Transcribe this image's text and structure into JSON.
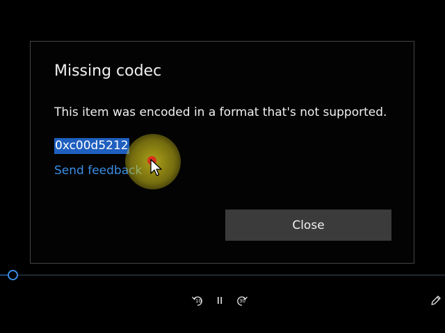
{
  "dialog": {
    "title": "Missing codec",
    "message": "This item was encoded in a format that's not supported.",
    "error_code": "0xc00d5212",
    "feedback_link": "Send feedback",
    "close_label": "Close"
  },
  "player": {
    "skip_back_seconds": "10",
    "skip_forward_seconds": "30",
    "buttons": {
      "skip_back_icon": "skip-back-10-icon",
      "pause_icon": "pause-icon",
      "skip_forward_icon": "skip-forward-30-icon",
      "edit_icon": "pen-icon"
    }
  },
  "colors": {
    "background": "#000000",
    "dialog_border": "#454545",
    "link": "#3a8ee6",
    "selection": "#1f5fbf",
    "close_button": "#3b3b3b",
    "cursor_highlight": "#d8cc1e",
    "cursor_dot": "#d8321e"
  }
}
